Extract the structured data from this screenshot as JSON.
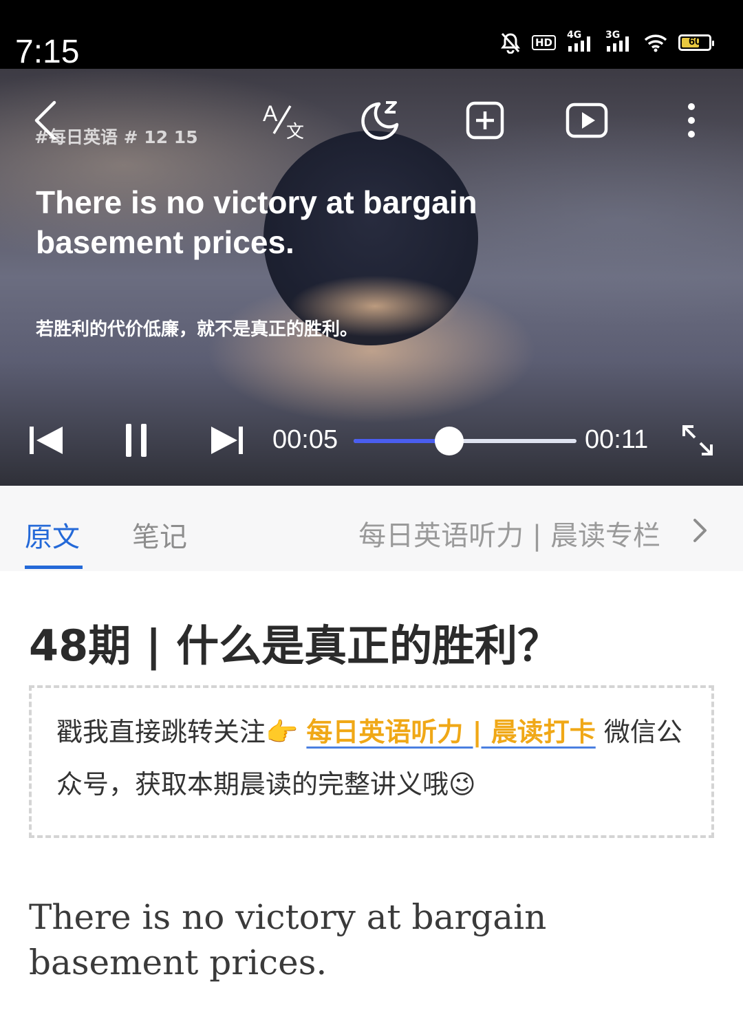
{
  "status_bar": {
    "time": "7:15",
    "hd_label": "HD",
    "sim1_label": "4G",
    "sim2_label": "3G",
    "battery_level": "60"
  },
  "player": {
    "hashtag": "#每日英语 # 12 15",
    "subtitle_en": "There is no victory at bargain basement prices.",
    "subtitle_zh": "若胜利的代价低廉，就不是真正的胜利。",
    "current_time": "00:05",
    "total_time": "00:11",
    "progress_fraction": 0.43,
    "icons": [
      "back-icon",
      "translate-icon",
      "sleep-timer-icon",
      "add-icon",
      "video-icon",
      "more-icon",
      "previous-icon",
      "pause-icon",
      "next-icon",
      "fullscreen-icon"
    ]
  },
  "tabs": {
    "items": [
      {
        "label": "原文",
        "active": true
      },
      {
        "label": "笔记",
        "active": false
      }
    ],
    "column_link": "每日英语听力 | 晨读专栏"
  },
  "article": {
    "title": "48期 | 什么是真正的胜利？",
    "notice_prefix": "戳我直接跳转关注👉 ",
    "notice_link": "每日英语听力 | 晨读打卡",
    "notice_suffix": " 微信公众号，获取本期晨读的完整讲义哦😉",
    "body": "There is no victory at bargain basement prices."
  },
  "colors": {
    "accent": "#2469d8",
    "progress": "#4a5ef0",
    "link": "#f0a817"
  }
}
